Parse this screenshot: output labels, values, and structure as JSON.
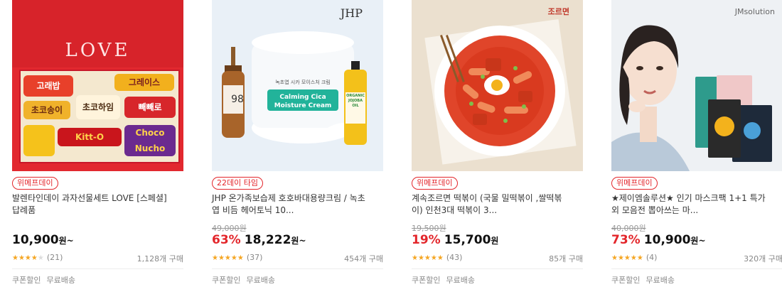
{
  "products": [
    {
      "badge": "위메프데이",
      "title_line1": "발렌타인데이 과자선물세트 LOVE [스페셜]",
      "title_line2": "답례품",
      "original_price": "",
      "discount": "",
      "price": "10,900",
      "price_unit": "원~",
      "stars_filled": "★★★★",
      "stars_empty": "★",
      "rating_value": 4,
      "review_count": "(21)",
      "purchases": "1,128개 구매",
      "tags": [
        "쿠폰할인",
        "무료배송"
      ],
      "image": {
        "box_text": "LOVE",
        "snacks": [
          "고래밥",
          "그레이스",
          "초코송이",
          "초코하임",
          "빼빼로",
          "Kitt-O",
          "Choco Nucho"
        ]
      }
    },
    {
      "badge": "22데이 타임",
      "title_line1": "JHP 온가족보습제 호호바대용량크림 / 녹초",
      "title_line2": "엽 비듬 헤어토닉 10...",
      "original_price": "49,000원",
      "discount": "63%",
      "price": "18,222",
      "price_unit": "원~",
      "stars_filled": "★★★★★",
      "stars_empty": "",
      "rating_value": 5,
      "review_count": "(37)",
      "purchases": "454개 구매",
      "tags": [
        "쿠폰할인",
        "무료배송"
      ],
      "image": {
        "brand": "JHP",
        "jar_label_small": "녹초엽 시카 모이스처 크림",
        "jar_label": "Calming Cica",
        "jar_label2": "Moisture Cream",
        "bottle_num": "98",
        "oil_label": "ORGANIC JOJOBA OIL"
      }
    },
    {
      "badge": "위메프데이",
      "title_line1": "계속조르면 떡볶이 (국물 밀떡볶이 ,쌀떡볶",
      "title_line2": "이) 인천3대 떡볶이 3...",
      "original_price": "19,500원",
      "discount": "19%",
      "price": "15,700",
      "price_unit": "원",
      "stars_filled": "★★★★★",
      "stars_empty": "",
      "rating_value": 5,
      "review_count": "(43)",
      "purchases": "85개 구매",
      "tags": [
        "쿠폰할인",
        "무료배송"
      ],
      "image": {
        "logo": "조르면"
      }
    },
    {
      "badge": "위메프데이",
      "title_line1": "★제이엠솔루션★ 인기 마스크팩 1+1 특가",
      "title_line2": "외 모음전 뽑아쓰는 마...",
      "original_price": "40,000원",
      "discount": "73%",
      "price": "10,900",
      "price_unit": "원~",
      "stars_filled": "★★★★★",
      "stars_empty": "",
      "rating_value": 5,
      "review_count": "(4)",
      "purchases": "320개 구매",
      "tags": [
        "쿠폰할인",
        "무료배송"
      ],
      "image": {
        "brand": "JMsolution"
      }
    }
  ],
  "colors": {
    "accent": "#e3262b",
    "star": "#f5a623",
    "muted": "#888888"
  }
}
